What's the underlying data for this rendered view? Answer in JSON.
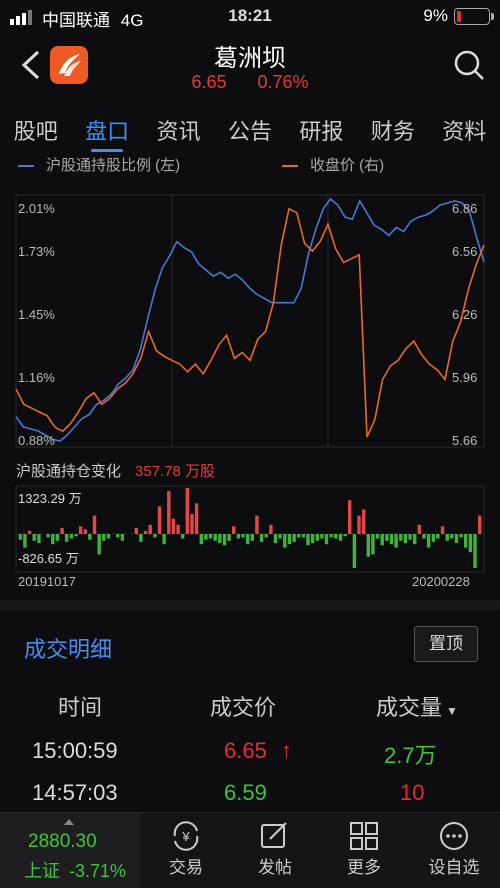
{
  "status": {
    "carrier": "中国联通",
    "network": "4G",
    "time": "18:21",
    "battery": "9%"
  },
  "header": {
    "name": "葛洲坝",
    "price": "6.65",
    "change": "0.76%"
  },
  "tabs": [
    "股吧",
    "盘口",
    "资讯",
    "公告",
    "研报",
    "财务",
    "资料"
  ],
  "legend": {
    "left": "沪股通持股比例 (左)",
    "right": "收盘价 (右)"
  },
  "chart_data": [
    {
      "type": "line",
      "series": [
        {
          "name": "沪股通持股比例 (左)",
          "values": [
            0.97,
            0.92,
            0.91,
            0.9,
            0.88,
            0.86,
            0.85,
            0.88,
            0.92,
            0.96,
            0.98,
            1.03,
            1.05,
            1.08,
            1.13,
            1.16,
            1.2,
            1.3,
            1.45,
            1.59,
            1.7,
            1.76,
            1.83,
            1.8,
            1.78,
            1.72,
            1.69,
            1.66,
            1.68,
            1.65,
            1.67,
            1.64,
            1.6,
            1.57,
            1.55,
            1.53,
            1.53,
            1.53,
            1.53,
            1.6,
            1.77,
            1.89,
            1.99,
            2.04,
            2.01,
            1.95,
            1.94,
            2.03,
            1.97,
            1.91,
            1.89,
            1.86,
            1.9,
            1.88,
            1.93,
            1.95,
            1.96,
            1.98,
            2.01,
            2.02,
            2.03,
            2.02,
            1.98,
            1.85,
            1.73
          ]
        },
        {
          "name": "收盘价 (右)",
          "values": [
            5.9,
            5.82,
            5.8,
            5.78,
            5.76,
            5.7,
            5.68,
            5.72,
            5.78,
            5.85,
            5.88,
            5.82,
            5.85,
            5.9,
            5.93,
            5.98,
            6.06,
            6.2,
            6.1,
            6.07,
            6.05,
            6.03,
            5.99,
            6.03,
            5.98,
            6.05,
            6.13,
            6.18,
            6.06,
            6.09,
            6.05,
            6.16,
            6.2,
            6.35,
            6.65,
            6.84,
            6.82,
            6.66,
            6.62,
            6.67,
            6.76,
            6.63,
            6.56,
            6.58,
            6.6,
            5.65,
            5.74,
            5.95,
            6.02,
            6.05,
            6.11,
            6.15,
            6.08,
            6.03,
            6.0,
            5.95,
            6.15,
            6.25,
            6.42,
            6.55,
            6.65
          ]
        }
      ],
      "left_ticks": [
        "2.01%",
        "1.73%",
        "1.45%",
        "1.16%",
        "0.88%"
      ],
      "right_ticks": [
        "6.86",
        "6.56",
        "6.26",
        "5.96",
        "5.66"
      ],
      "left_range": [
        0.88,
        2.01
      ],
      "right_range": [
        5.66,
        6.86
      ]
    },
    {
      "type": "bar",
      "title": "沪股通持仓变化",
      "total": "357.78 万股",
      "max_label": "1323.29 万",
      "min_label": "-826.65 万",
      "x_start": "20191017",
      "x_end": "20200228",
      "values": [
        -50,
        -120,
        20,
        -60,
        -80,
        0,
        -30,
        -90,
        -60,
        40,
        -70,
        -40,
        -20,
        50,
        30,
        -50,
        120,
        -180,
        -60,
        -40,
        0,
        -30,
        -60,
        0,
        0,
        40,
        -70,
        20,
        60,
        -30,
        180,
        -90,
        280,
        100,
        60,
        -40,
        300,
        130,
        200,
        -90,
        -50,
        -40,
        -60,
        -80,
        -100,
        -60,
        50,
        -40,
        -30,
        -90,
        -60,
        120,
        -70,
        -30,
        60,
        -80,
        -40,
        -120,
        -90,
        -70,
        -30,
        -30,
        -100,
        -80,
        -60,
        -40,
        -90,
        -30,
        -40,
        -60,
        -20,
        220,
        -300,
        120,
        160,
        -200,
        -180,
        -40,
        -100,
        -60,
        -90,
        -120,
        -60,
        -80,
        -50,
        -90,
        60,
        -40,
        -120,
        -70,
        -40,
        50,
        -60,
        -40,
        -80,
        -30,
        -120,
        -160,
        -300,
        120
      ]
    }
  ],
  "detail": {
    "title": "成交明细",
    "pin_label": "置顶",
    "headers": [
      "时间",
      "成交价",
      "成交量"
    ],
    "rows": [
      {
        "time": "15:00:59",
        "price": "6.65",
        "arrow": "↑",
        "volume": "2.7万"
      },
      {
        "time": "14:57:03",
        "price": "6.59",
        "arrow": "",
        "volume": "10"
      }
    ]
  },
  "index": {
    "value": "2880.30",
    "name": "上证",
    "change": "-3.71%"
  },
  "nav": [
    "交易",
    "发帖",
    "更多",
    "设自选"
  ]
}
